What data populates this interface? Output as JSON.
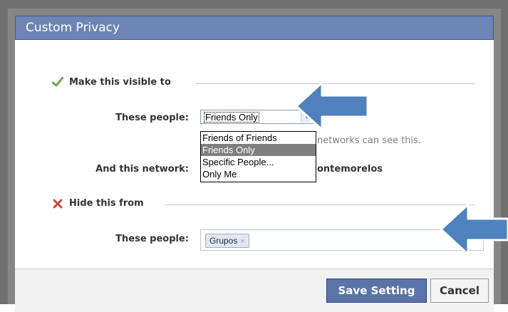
{
  "dialog": {
    "title": "Custom Privacy",
    "visible_section": {
      "label": "Make this visible to",
      "people_label": "These people:",
      "select_value": "Friends Only",
      "options": [
        "Friends of Friends",
        "Friends Only",
        "Specific People...",
        "Only Me"
      ],
      "selected_option": "Friends Only",
      "hint": "networks can see this.",
      "network_label": "And this network:",
      "network_value": "ontemorelos"
    },
    "hide_section": {
      "label": "Hide this from",
      "people_label": "These people:",
      "token": "Grupos",
      "token_remove": "×"
    },
    "buttons": {
      "save": "Save Setting",
      "cancel": "Cancel"
    }
  },
  "colors": {
    "titlebar": "#6d84b4",
    "save_button": "#5b74a8",
    "check_icon": "#6aa84f",
    "x_icon": "#cc4444",
    "arrow_fill": "#4f81bd"
  },
  "icons": {
    "visible": "check-icon",
    "hide": "x-icon",
    "annotation": "arrow-icon"
  }
}
